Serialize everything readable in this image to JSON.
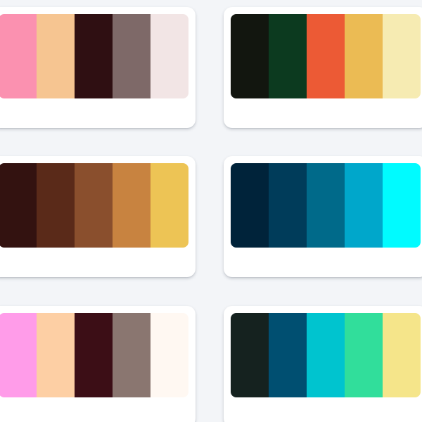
{
  "palettes": [
    {
      "colors": [
        "#fb91b0",
        "#f6c591",
        "#2f0f12",
        "#7e6968",
        "#f2e5e5"
      ]
    },
    {
      "colors": [
        "#12160f",
        "#0c3a1f",
        "#ec5a35",
        "#ebbb54",
        "#f6ebb2"
      ]
    },
    {
      "colors": [
        "#331210",
        "#5a2a19",
        "#8a4f2d",
        "#c88340",
        "#edc455"
      ]
    },
    {
      "colors": [
        "#00233a",
        "#003c5a",
        "#006a8a",
        "#00a7cb",
        "#00fbff"
      ]
    },
    {
      "colors": [
        "#ff9ce9",
        "#fdcfa4",
        "#3c0e16",
        "#8a7670",
        "#fff8f2"
      ]
    },
    {
      "colors": [
        "#15221f",
        "#004f71",
        "#00c4cf",
        "#31de9b",
        "#f5e58a"
      ]
    }
  ]
}
